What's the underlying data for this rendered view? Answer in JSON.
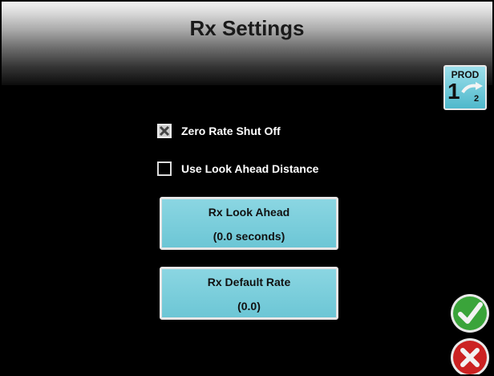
{
  "header": {
    "title": "Rx Settings"
  },
  "product_button": {
    "label": "PROD",
    "from": "1",
    "to": "2"
  },
  "options": [
    {
      "label": "Zero Rate Shut Off",
      "checked": true
    },
    {
      "label": "Use Look Ahead Distance",
      "checked": false
    }
  ],
  "look_ahead_button": {
    "title": "Rx Look Ahead",
    "value": "(0.0 seconds)"
  },
  "default_rate_button": {
    "title": "Rx Default Rate",
    "value": "(0.0)"
  },
  "actions": {
    "accept_icon": "checkmark-icon",
    "cancel_icon": "x-icon"
  },
  "colors": {
    "button_teal": "#7ccfdc",
    "accept_green": "#3aa43a",
    "cancel_red": "#cc2222"
  }
}
